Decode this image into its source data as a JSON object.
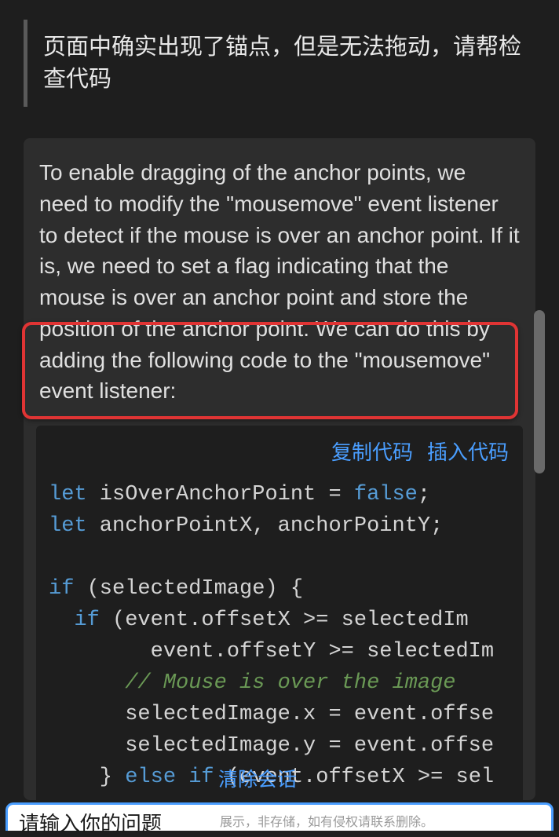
{
  "user_message": "页面中确实出现了锚点，但是无法拖动，请帮检查代码",
  "assistant_response": "To enable dragging of the anchor points, we need to modify the \"mousemove\" event listener to detect if the mouse is over an anchor point. If it is, we need to set a flag indicating that the mouse is over an anchor point and store the position of the anchor point. We can do this by adding the following code to the \"mousemove\" event listener:",
  "code_actions": {
    "copy": "复制代码",
    "insert": "插入代码"
  },
  "code": {
    "line1_kw": "let",
    "line1_rest": " isOverAnchorPoint = ",
    "line1_bool": "false",
    "line1_semi": ";",
    "line2_kw": "let",
    "line2_rest": " anchorPointX, anchorPointY;",
    "line4_kw": "if",
    "line4_rest": " (selectedImage) {",
    "line5_kw": "if",
    "line5_rest": " (event.offsetX >= selectedIm",
    "line6": "        event.offsetY >= selectedIm",
    "line7_comment": "// Mouse is over the image",
    "line8": "      selectedImage.x = event.offse",
    "line9": "      selectedImage.y = event.offse",
    "line10_close": "    } ",
    "line10_else": "else",
    "line10_if": " if",
    "line10_rest": " (event.offsetX >= sel"
  },
  "clear_session": "清除会话",
  "input_placeholder": "请输入你的问题",
  "input_hint": "展示，非存储，如有侵权请联系删除。"
}
